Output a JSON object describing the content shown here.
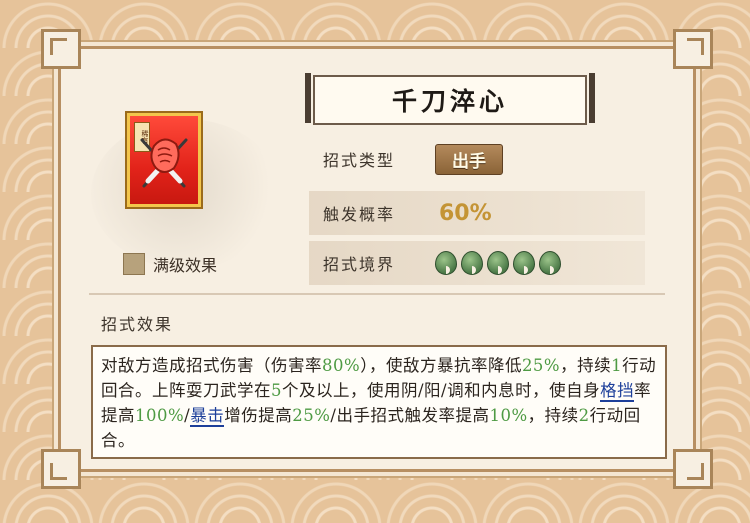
{
  "skill": {
    "name": "千刀淬心",
    "icon_name": "fist-with-blades-icon",
    "icon_tag": "稀有"
  },
  "attributes": [
    {
      "label": "招式类型",
      "value": "出手"
    },
    {
      "label": "触发概率",
      "value": "60%"
    },
    {
      "label": "招式境界",
      "value": 5
    }
  ],
  "max_level": {
    "label": "满级效果",
    "checked": false
  },
  "effect": {
    "title": "招式效果",
    "segments": [
      {
        "t": "对敌方造成招式伤害（伤害率"
      },
      {
        "t": "80%",
        "c": "g"
      },
      {
        "t": "），使敌方暴抗率降低"
      },
      {
        "t": "25%",
        "c": "g"
      },
      {
        "t": "，持续"
      },
      {
        "t": "1",
        "c": "g"
      },
      {
        "t": "行动回合。上阵耍刀武学在"
      },
      {
        "t": "5",
        "c": "g"
      },
      {
        "t": "个及以上，使用阴/阳/调和内息时，使自身"
      },
      {
        "t": "格挡",
        "c": "k"
      },
      {
        "t": "率提高"
      },
      {
        "t": "100%",
        "c": "g"
      },
      {
        "t": "/"
      },
      {
        "t": "暴击",
        "c": "k"
      },
      {
        "t": "增伤提高"
      },
      {
        "t": "25%",
        "c": "g"
      },
      {
        "t": "/出手招式触发率提高"
      },
      {
        "t": "10%",
        "c": "g"
      },
      {
        "t": "，持续"
      },
      {
        "t": "2",
        "c": "g"
      },
      {
        "t": "行动回合。"
      }
    ]
  },
  "colors": {
    "highlight": "#4e9a43",
    "keyword": "#1d3f9a",
    "rate": "#c49435"
  }
}
